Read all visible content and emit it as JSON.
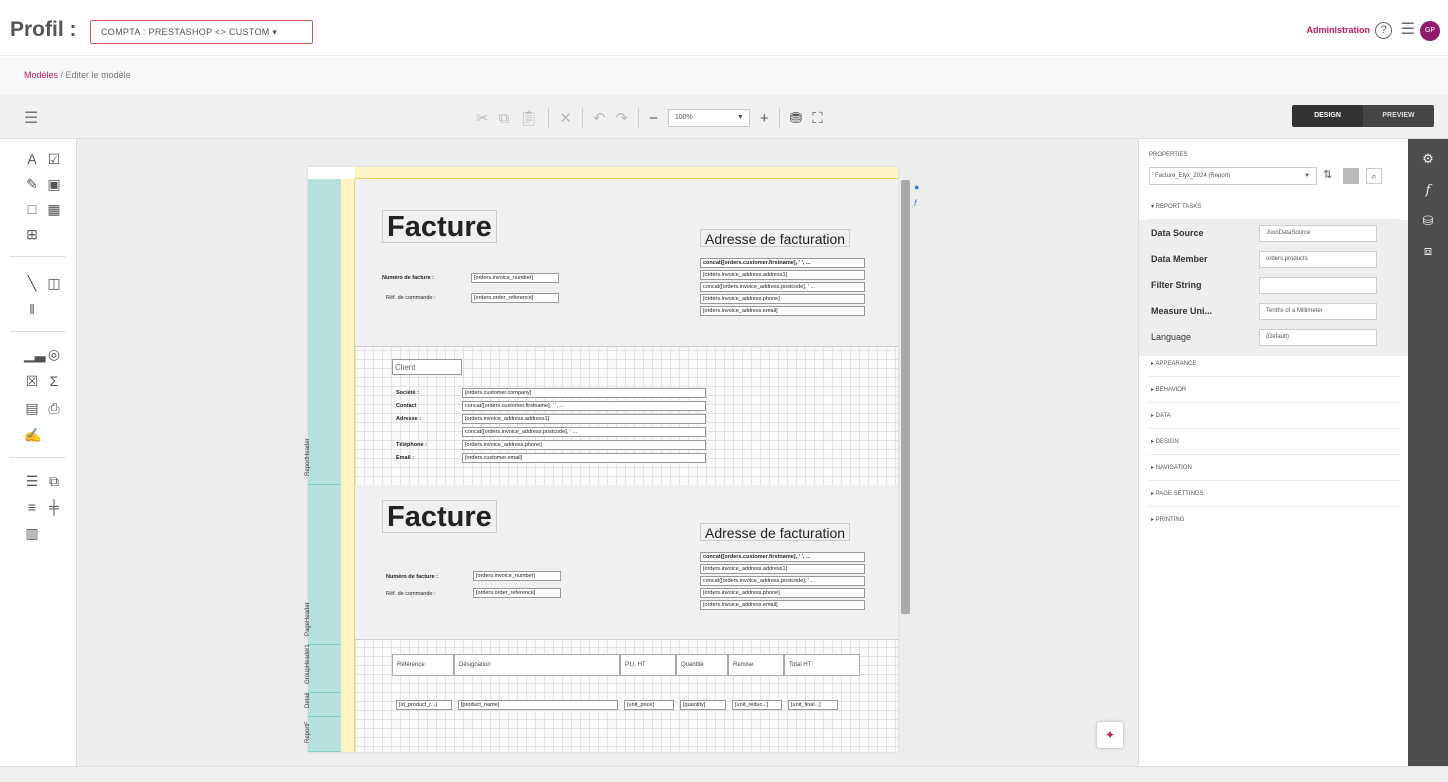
{
  "topbar": {
    "title": "Profil :",
    "profile_select": "COMPTA : PRESTASHOP <> CUSTOM ▾",
    "admin": "Administration",
    "help": "?",
    "menu": "☰",
    "avatar": "GP"
  },
  "breadcrumb": {
    "link": "Modèles",
    "sep": " / ",
    "current": "Editer le modèle"
  },
  "toolbar": {
    "zoom": "100%",
    "design": "DESIGN",
    "preview": "PREVIEW"
  },
  "report": {
    "facture": "Facture",
    "adresse": "Adresse de facturation",
    "numero_label": "Numéro de facture :",
    "numero_value": "[orders.invoice_number]",
    "ref_label": "Réf. de commande :",
    "ref_value": "[orders.order_reference]",
    "addr_lines": [
      "concat([orders.customer.firstname], ' ', ...",
      "[orders.invoice_address.address1]",
      "concat([orders.invoice_address.postcode], ' ...",
      "[orders.invoice_address.phone]",
      "[orders.invoice_address.email]"
    ],
    "client": "Client",
    "client_rows": [
      {
        "k": "Société :",
        "v": "[orders.customer.company]"
      },
      {
        "k": "Contact",
        "v": "concat([orders.customer.firstname], ' ', ..."
      },
      {
        "k": "Adresse :",
        "v": "[orders.invoice_address.address1]"
      },
      {
        "k": "",
        "v": "concat([orders.invoice_address.postcode], ' ..."
      },
      {
        "k": "Téléphone :",
        "v": "[orders.invoice_address.phone]"
      },
      {
        "k": "Email :",
        "v": "[orders.customer.email]"
      }
    ],
    "table_headers": [
      "Référence",
      "Désignation",
      "P.U. HT",
      "Quantité",
      "Remise",
      "Total HT"
    ],
    "detail_cells": [
      "[id_product_r...]",
      "[product_name]",
      "[unit_price]",
      "[quantity]",
      "[unit_reduc...]",
      "[unit_final...]"
    ],
    "bands": {
      "report_header": "ReportHeader",
      "page_header": "PageHeader",
      "group_header": "GroupHeader1",
      "detail": "Detail",
      "report_footer": "ReportF"
    }
  },
  "properties": {
    "title": "PROPERTIES",
    "object": "Facture_Elyx_2024 (Report)",
    "report_tasks": "▾ REPORT TASKS",
    "rows": [
      {
        "k": "Data Source",
        "v": "JsonDataSource"
      },
      {
        "k": "Data Member",
        "v": "orders.products"
      },
      {
        "k": "Filter String",
        "v": ""
      },
      {
        "k": "Measure Uni...",
        "v": "Tenths of a Millimeter"
      },
      {
        "k": "Language",
        "v": "(Default)"
      }
    ],
    "sections": [
      "▸ APPEARANCE",
      "▸ BEHAVIOR",
      "▸ DATA",
      "▸ DESIGN",
      "▸ NAVIGATION",
      "▸ PAGE SETTINGS",
      "▸ PRINTING"
    ]
  },
  "colors": {
    "accent": "#c2185b",
    "sidebar": "#4d4d4d",
    "band": "#b7e0dc",
    "ruler": "#fdf6c4"
  }
}
